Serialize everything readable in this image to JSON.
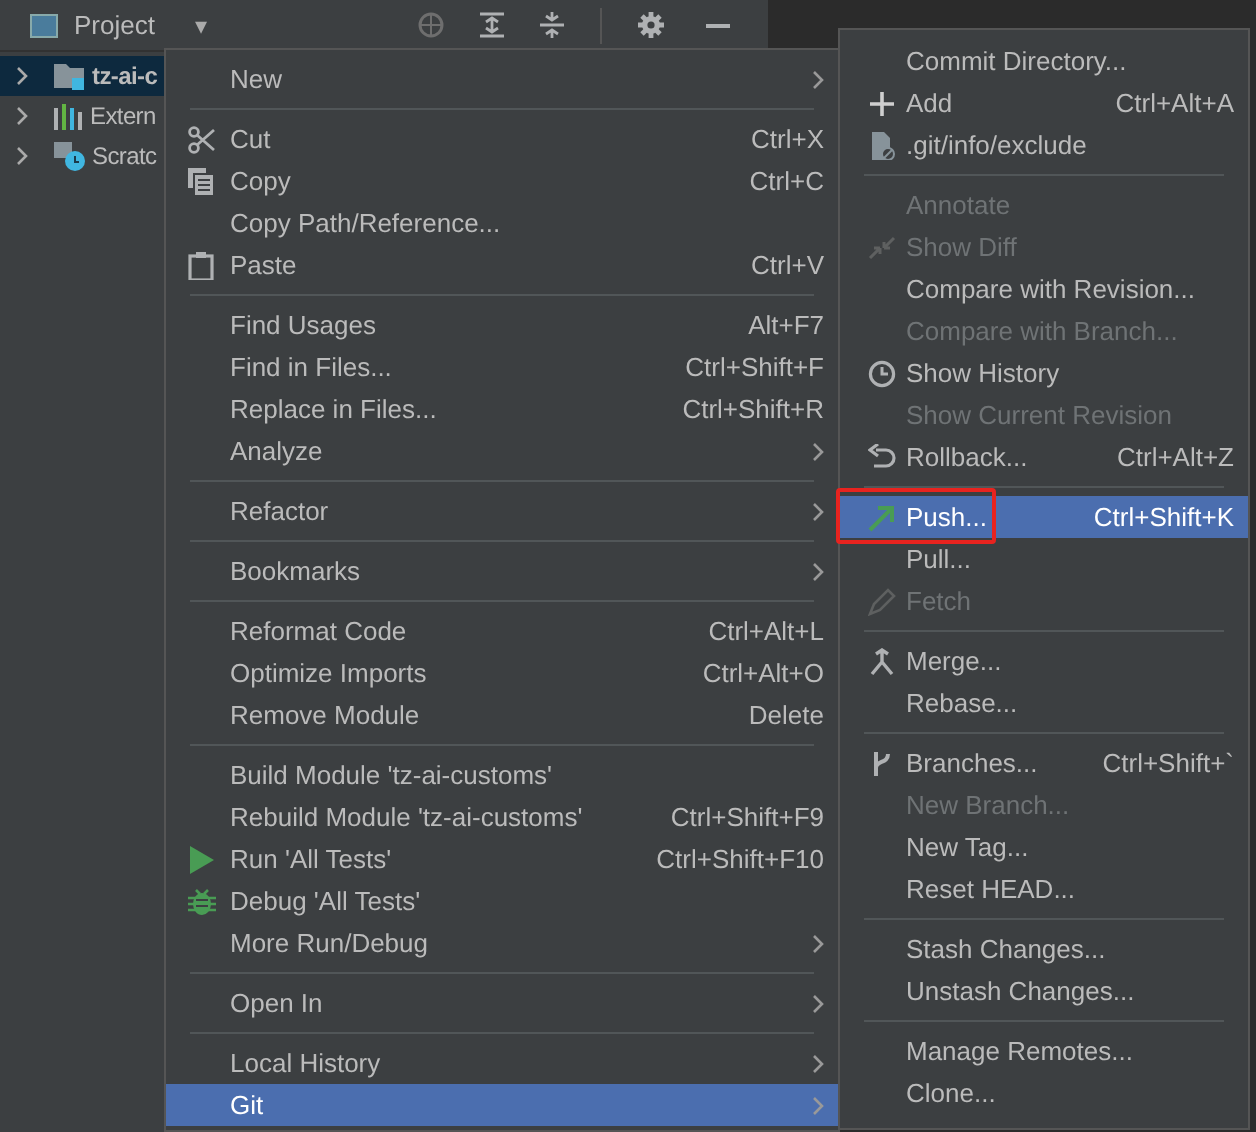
{
  "tool_window": {
    "title": "Project",
    "dropdown": "▾"
  },
  "tree": [
    {
      "label": "tz-ai-c",
      "kind": "module",
      "selected": true
    },
    {
      "label": "Extern",
      "kind": "library",
      "selected": false
    },
    {
      "label": "Scratc",
      "kind": "scratches",
      "selected": false
    }
  ],
  "context_menu": {
    "items": [
      {
        "kind": "item",
        "label": "New",
        "submenu": true,
        "selected": false,
        "disabled": false
      },
      {
        "kind": "separator"
      },
      {
        "kind": "item",
        "label": "Cut",
        "shortcut": "Ctrl+X",
        "selected": false,
        "disabled": false
      },
      {
        "kind": "item",
        "label": "Copy",
        "shortcut": "Ctrl+C",
        "selected": false,
        "disabled": false
      },
      {
        "kind": "item",
        "label": "Copy Path/Reference...",
        "selected": false,
        "disabled": false
      },
      {
        "kind": "item",
        "label": "Paste",
        "shortcut": "Ctrl+V",
        "selected": false,
        "disabled": false
      },
      {
        "kind": "separator"
      },
      {
        "kind": "item",
        "label": "Find Usages",
        "shortcut": "Alt+F7",
        "selected": false,
        "disabled": false
      },
      {
        "kind": "item",
        "label": "Find in Files...",
        "shortcut": "Ctrl+Shift+F",
        "selected": false,
        "disabled": false
      },
      {
        "kind": "item",
        "label": "Replace in Files...",
        "shortcut": "Ctrl+Shift+R",
        "selected": false,
        "disabled": false
      },
      {
        "kind": "item",
        "label": "Analyze",
        "submenu": true,
        "selected": false,
        "disabled": false
      },
      {
        "kind": "separator"
      },
      {
        "kind": "item",
        "label": "Refactor",
        "submenu": true,
        "selected": false,
        "disabled": false
      },
      {
        "kind": "separator"
      },
      {
        "kind": "item",
        "label": "Bookmarks",
        "submenu": true,
        "selected": false,
        "disabled": false
      },
      {
        "kind": "separator"
      },
      {
        "kind": "item",
        "label": "Reformat Code",
        "shortcut": "Ctrl+Alt+L",
        "selected": false,
        "disabled": false
      },
      {
        "kind": "item",
        "label": "Optimize Imports",
        "shortcut": "Ctrl+Alt+O",
        "selected": false,
        "disabled": false
      },
      {
        "kind": "item",
        "label": "Remove Module",
        "shortcut": "Delete",
        "selected": false,
        "disabled": false
      },
      {
        "kind": "separator"
      },
      {
        "kind": "item",
        "label": "Build Module 'tz-ai-customs'",
        "selected": false,
        "disabled": false
      },
      {
        "kind": "item",
        "label": "Rebuild Module 'tz-ai-customs'",
        "shortcut": "Ctrl+Shift+F9",
        "selected": false,
        "disabled": false
      },
      {
        "kind": "item",
        "label": "Run 'All Tests'",
        "shortcut": "Ctrl+Shift+F10",
        "selected": false,
        "disabled": false
      },
      {
        "kind": "item",
        "label": "Debug 'All Tests'",
        "selected": false,
        "disabled": false
      },
      {
        "kind": "item",
        "label": "More Run/Debug",
        "submenu": true,
        "selected": false,
        "disabled": false
      },
      {
        "kind": "separator"
      },
      {
        "kind": "item",
        "label": "Open In",
        "submenu": true,
        "selected": false,
        "disabled": false
      },
      {
        "kind": "separator"
      },
      {
        "kind": "item",
        "label": "Local History",
        "submenu": true,
        "selected": false,
        "disabled": false
      },
      {
        "kind": "item",
        "label": "Git",
        "submenu": true,
        "selected": true,
        "disabled": false
      }
    ]
  },
  "git_submenu": {
    "items": [
      {
        "kind": "item",
        "label": "Commit Directory...",
        "selected": false,
        "disabled": false,
        "outlined": false
      },
      {
        "kind": "item",
        "label": "Add",
        "shortcut": "Ctrl+Alt+A",
        "selected": false,
        "disabled": false,
        "outlined": false
      },
      {
        "kind": "item",
        "label": ".git/info/exclude",
        "selected": false,
        "disabled": false,
        "outlined": false
      },
      {
        "kind": "separator"
      },
      {
        "kind": "item",
        "label": "Annotate",
        "selected": false,
        "disabled": true,
        "outlined": false
      },
      {
        "kind": "item",
        "label": "Show Diff",
        "selected": false,
        "disabled": true,
        "outlined": false
      },
      {
        "kind": "item",
        "label": "Compare with Revision...",
        "selected": false,
        "disabled": false,
        "outlined": false
      },
      {
        "kind": "item",
        "label": "Compare with Branch...",
        "selected": false,
        "disabled": true,
        "outlined": false
      },
      {
        "kind": "item",
        "label": "Show History",
        "selected": false,
        "disabled": false,
        "outlined": false
      },
      {
        "kind": "item",
        "label": "Show Current Revision",
        "selected": false,
        "disabled": true,
        "outlined": false
      },
      {
        "kind": "item",
        "label": "Rollback...",
        "shortcut": "Ctrl+Alt+Z",
        "selected": false,
        "disabled": false,
        "outlined": false
      },
      {
        "kind": "separator"
      },
      {
        "kind": "item",
        "label": "Push...",
        "shortcut": "Ctrl+Shift+K",
        "selected": true,
        "disabled": false,
        "outlined": true
      },
      {
        "kind": "item",
        "label": "Pull...",
        "selected": false,
        "disabled": false,
        "outlined": false
      },
      {
        "kind": "item",
        "label": "Fetch",
        "selected": false,
        "disabled": true,
        "outlined": false
      },
      {
        "kind": "separator"
      },
      {
        "kind": "item",
        "label": "Merge...",
        "selected": false,
        "disabled": false,
        "outlined": false
      },
      {
        "kind": "item",
        "label": "Rebase...",
        "selected": false,
        "disabled": false,
        "outlined": false
      },
      {
        "kind": "separator"
      },
      {
        "kind": "item",
        "label": "Branches...",
        "shortcut": "Ctrl+Shift+`",
        "selected": false,
        "disabled": false,
        "outlined": false
      },
      {
        "kind": "item",
        "label": "New Branch...",
        "selected": false,
        "disabled": true,
        "outlined": false
      },
      {
        "kind": "item",
        "label": "New Tag...",
        "selected": false,
        "disabled": false,
        "outlined": false
      },
      {
        "kind": "item",
        "label": "Reset HEAD...",
        "selected": false,
        "disabled": false,
        "outlined": false
      },
      {
        "kind": "separator"
      },
      {
        "kind": "item",
        "label": "Stash Changes...",
        "selected": false,
        "disabled": false,
        "outlined": false
      },
      {
        "kind": "item",
        "label": "Unstash Changes...",
        "selected": false,
        "disabled": false,
        "outlined": false
      },
      {
        "kind": "separator"
      },
      {
        "kind": "item",
        "label": "Manage Remotes...",
        "selected": false,
        "disabled": false,
        "outlined": false
      },
      {
        "kind": "item",
        "label": "Clone...",
        "selected": false,
        "disabled": false,
        "outlined": false
      }
    ]
  }
}
